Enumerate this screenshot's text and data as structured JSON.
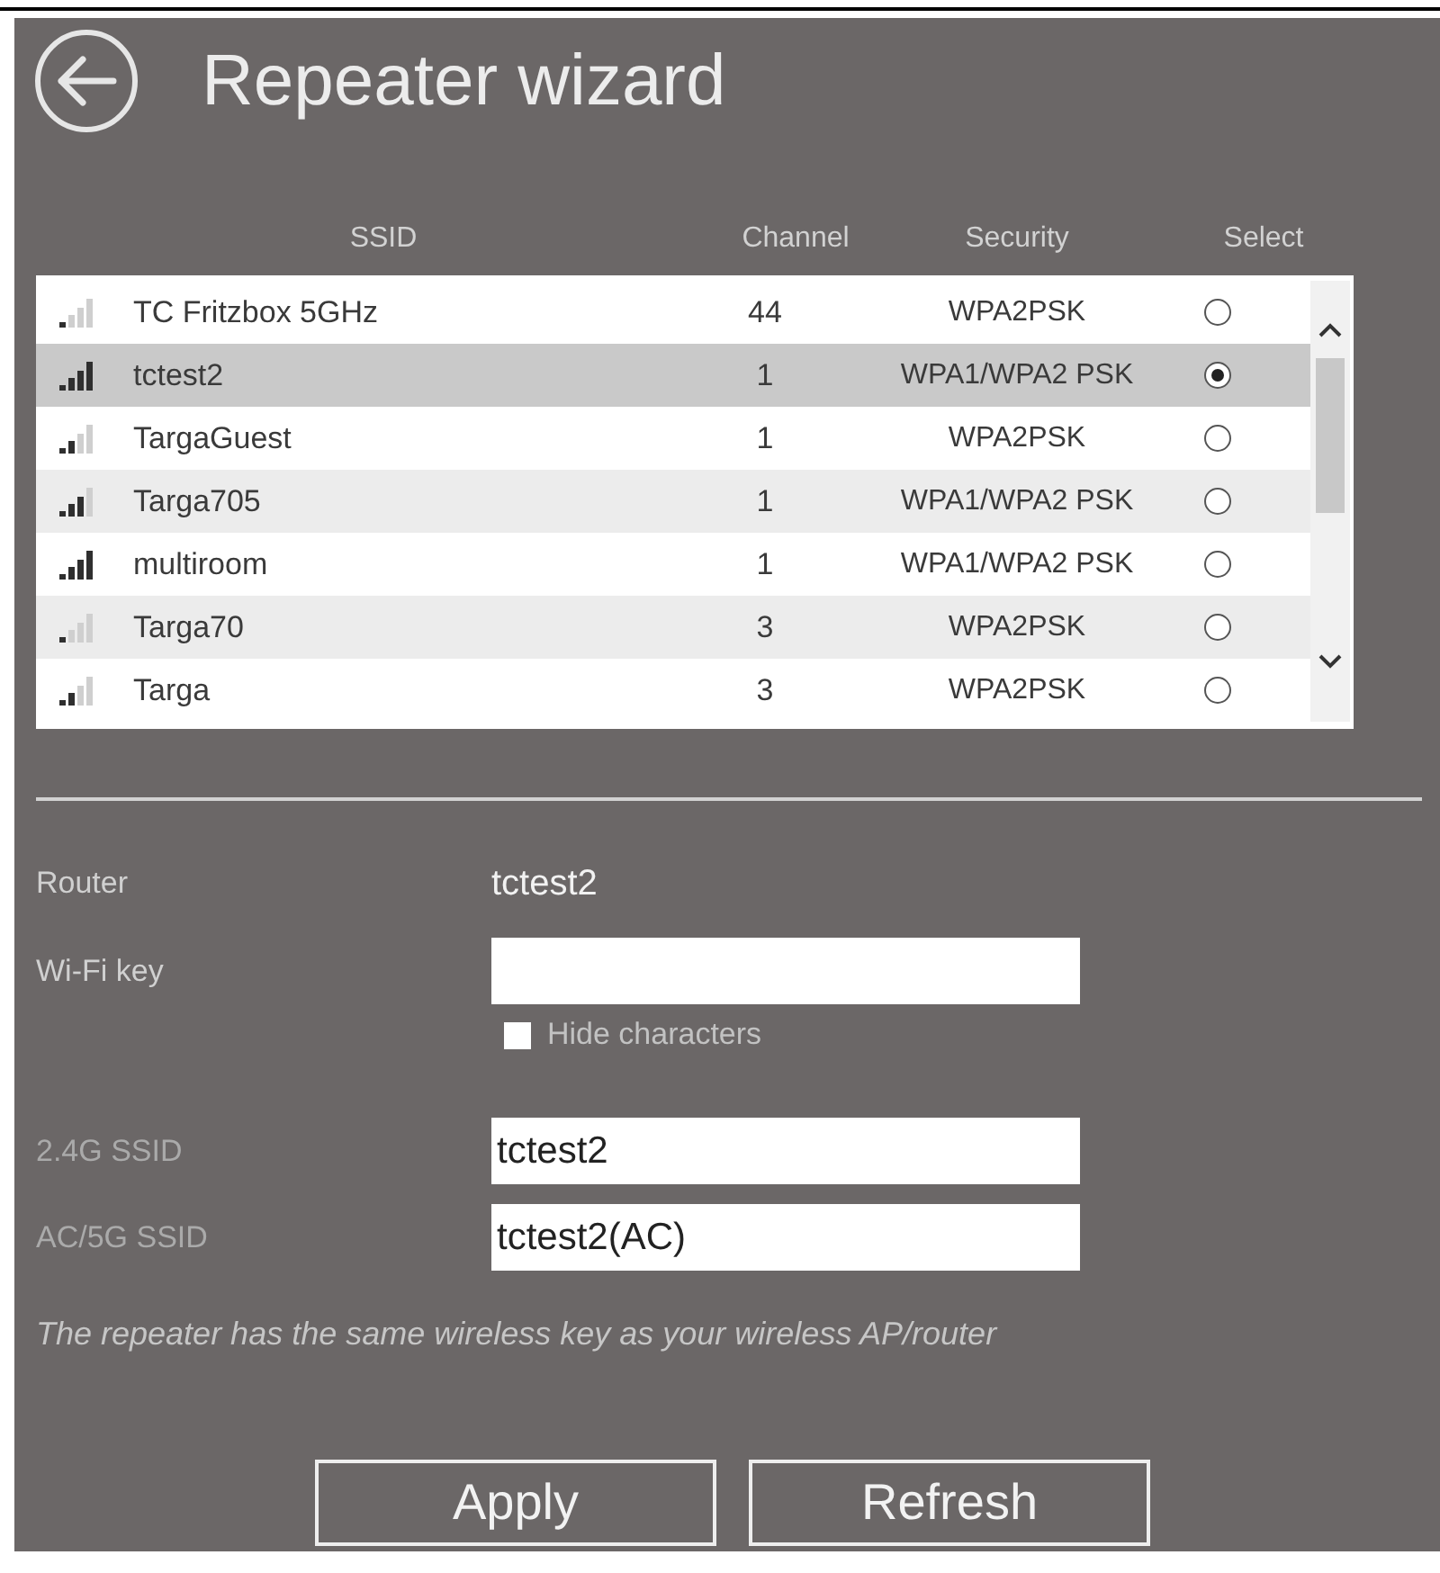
{
  "window": {
    "title": "Repeater wizard"
  },
  "table": {
    "columns": [
      "SSID",
      "Channel",
      "Security",
      "Select"
    ],
    "rows": [
      {
        "kind": "weak",
        "ssid": "TC Fritzbox 5GHz",
        "channel": "44",
        "security": "WPA2PSK",
        "selected": false
      },
      {
        "kind": "excellent",
        "ssid": "tctest2",
        "channel": "1",
        "security": "WPA1/WPA2 PSK",
        "selected": true
      },
      {
        "kind": "fair",
        "ssid": "TargaGuest",
        "channel": "1",
        "security": "WPA2PSK",
        "selected": false
      },
      {
        "kind": "good",
        "ssid": "Targa705",
        "channel": "1",
        "security": "WPA1/WPA2 PSK",
        "selected": false
      },
      {
        "kind": "excellent",
        "ssid": "multiroom",
        "channel": "1",
        "security": "WPA1/WPA2 PSK",
        "selected": false
      },
      {
        "kind": "weak",
        "ssid": "Targa70",
        "channel": "3",
        "security": "WPA2PSK",
        "selected": false
      },
      {
        "kind": "fair",
        "ssid": "Targa",
        "channel": "3",
        "security": "WPA2PSK",
        "selected": false
      }
    ]
  },
  "form": {
    "router": {
      "label": "Router",
      "value": "tctest2"
    },
    "wifi_key": {
      "label": "Wi-Fi key"
    },
    "hide_characters": {
      "label": "Hide characters",
      "checked": false
    },
    "ssid_24g": {
      "label": "2.4G SSID",
      "value": "tctest2"
    },
    "ssid_5g": {
      "label": "AC/5G SSID",
      "value": "tctest2(AC)"
    },
    "note": "The repeater has the same wireless key as your wireless AP/router"
  },
  "buttons": [
    "Apply",
    "Refresh"
  ]
}
